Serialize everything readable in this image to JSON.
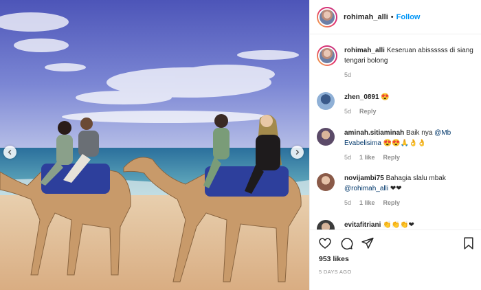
{
  "post": {
    "author": "rohimah_alli",
    "follow_label": "Follow",
    "dot": "•",
    "caption_user": "rohimah_alli",
    "caption_text": "Keseruan abissssss di siang tengari bolong",
    "caption_age": "5d",
    "likes": "953 likes",
    "posted": "5 DAYS AGO"
  },
  "comments": [
    {
      "user": "zhen_0891",
      "text": "😍",
      "age": "5d",
      "likes": "",
      "reply": "Reply"
    },
    {
      "user": "aminah.sitiaminah",
      "text_before": "Baik nya ",
      "mention": "@Mb Evabelisima",
      "text_after": "😍😍🙏👌👌",
      "age": "5d",
      "likes": "1 like",
      "reply": "Reply"
    },
    {
      "user": "novijambi75",
      "text_before": "Bahagia slalu mbak ",
      "mention": "@rohimah_alli",
      "text_after": " ❤❤",
      "age": "5d",
      "likes": "1 like",
      "reply": "Reply"
    },
    {
      "user": "evitafitriani",
      "text": "👏👏👏❤",
      "age": "",
      "likes": "",
      "reply": ""
    }
  ],
  "icons": [
    "heart-icon",
    "comment-icon",
    "share-icon",
    "bookmark-icon",
    "chevron-left-icon",
    "chevron-right-icon"
  ],
  "colors": {
    "link": "#0095f6",
    "mention": "#00376b",
    "muted": "#8e8e8e",
    "text": "#262626"
  }
}
